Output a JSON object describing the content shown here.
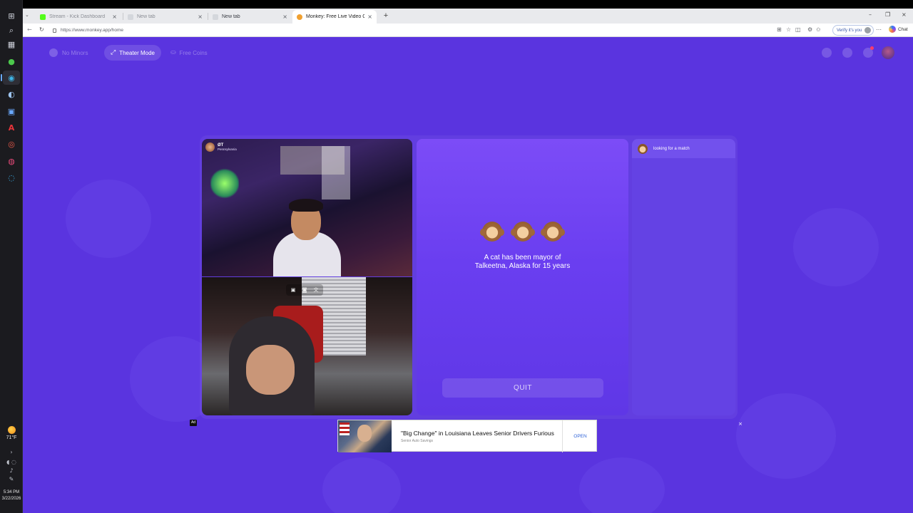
{
  "taskbar": {
    "apps": [
      {
        "name": "windows-start-icon",
        "glyph": "⊞"
      },
      {
        "name": "search-icon",
        "glyph": "⌕"
      },
      {
        "name": "task-view-icon",
        "glyph": "▦"
      },
      {
        "name": "xbox-icon",
        "glyph": "●"
      },
      {
        "name": "edge-icon",
        "glyph": "◉"
      },
      {
        "name": "steam-icon",
        "glyph": "◐"
      },
      {
        "name": "store-icon",
        "glyph": "▣"
      },
      {
        "name": "acrobat-icon",
        "glyph": "A"
      },
      {
        "name": "app-red-icon",
        "glyph": "◎"
      },
      {
        "name": "chrome-icon",
        "glyph": "◍"
      },
      {
        "name": "app-blue-icon",
        "glyph": "◌"
      }
    ],
    "weather": {
      "temp": "71°F"
    },
    "clock": {
      "time": "5:34 PM",
      "date": "3/22/2026"
    }
  },
  "browser": {
    "tabs": [
      {
        "label": "Stream - Kick Dashboard",
        "color": "#53fc18"
      },
      {
        "label": "New tab",
        "color": "#c0c4cc"
      },
      {
        "label": "New tab",
        "color": "#c0c4cc"
      },
      {
        "label": "Monkey: Free Live Video Chat",
        "color": "#f0a030"
      }
    ],
    "new_tab_glyph": "+",
    "url": "https://www.monkey.app/home",
    "verify_label": "Verify it's you",
    "copilot_label": "Chat"
  },
  "page": {
    "nav": {
      "left": [
        {
          "label": "No Minors"
        },
        {
          "label": "Theater Mode",
          "icon": "⤢"
        },
        {
          "label": "Free Coins",
          "icon": "⛀"
        }
      ]
    },
    "video_top": {
      "username": "ØT",
      "location": "Pennsylvania"
    },
    "monkeys": [
      "see-no-evil",
      "hear-no-evil",
      "speak-no-evil"
    ],
    "fact_lines": [
      "A cat has been mayor of",
      "Talkeetna, Alaska for 15 years"
    ],
    "quit_label": "QUIT",
    "chat_status": "looking for a match"
  },
  "ad": {
    "marker": "Ad",
    "headline": "\"Big Change\" in Louisiana Leaves Senior Drivers Furious",
    "sponsor": "Senior Auto Savings",
    "open_label": "OPEN",
    "close_glyph": "×"
  },
  "colors": {
    "page_bg": "#5a34df",
    "center_panel": "#7c4cf7",
    "ad_link": "#2f63d8"
  }
}
